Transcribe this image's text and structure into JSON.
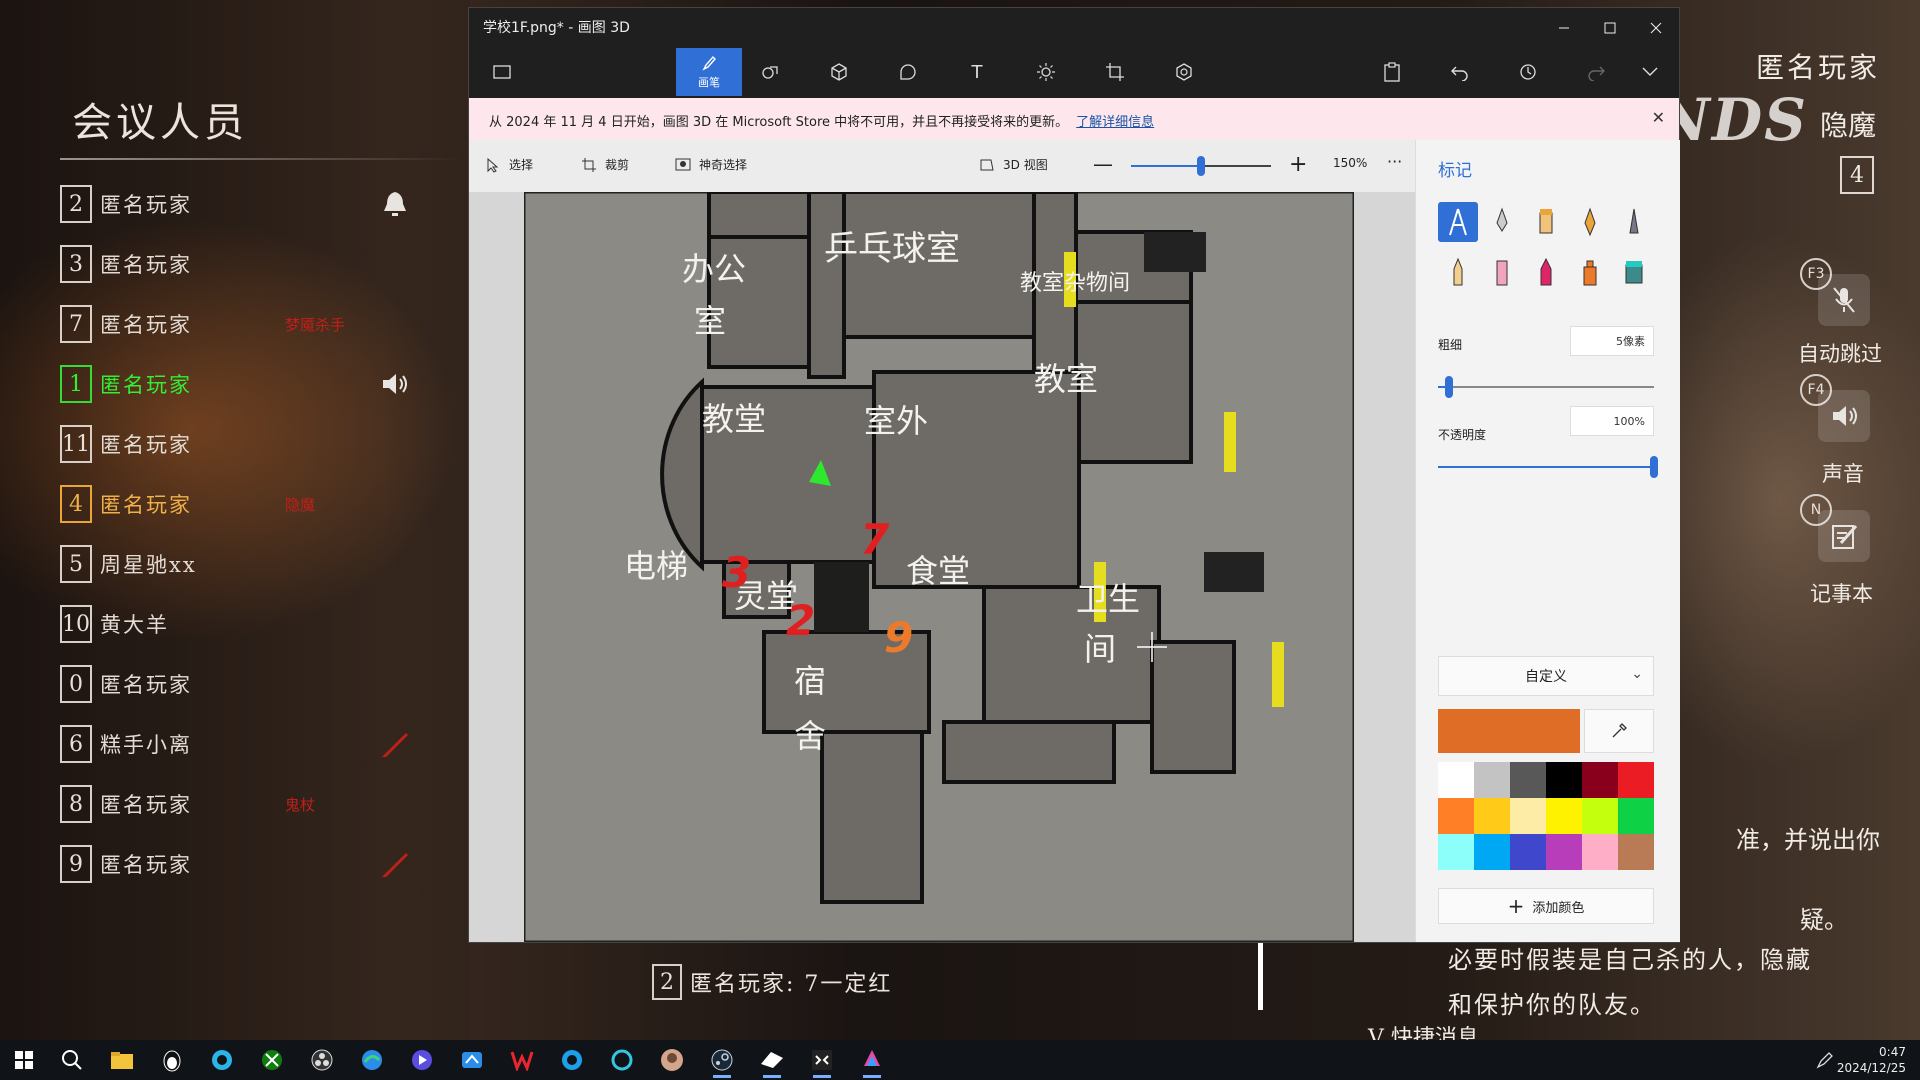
{
  "meeting": {
    "title": "会议人员",
    "players": [
      {
        "num": "2",
        "name": "匿名玩家",
        "style": "normal",
        "note": "",
        "icon": "bell-icon"
      },
      {
        "num": "3",
        "name": "匿名玩家",
        "style": "normal",
        "note": "",
        "icon": ""
      },
      {
        "num": "7",
        "name": "匿名玩家",
        "style": "normal",
        "note": "梦魇杀手",
        "icon": ""
      },
      {
        "num": "1",
        "name": "匿名玩家",
        "style": "green",
        "note": "",
        "icon": "speaker-icon"
      },
      {
        "num": "11",
        "name": "匿名玩家",
        "style": "normal",
        "note": "",
        "icon": ""
      },
      {
        "num": "4",
        "name": "匿名玩家",
        "style": "orange",
        "note": "隐魔",
        "icon": ""
      },
      {
        "num": "5",
        "name": "周星驰xx",
        "style": "normal",
        "note": "",
        "icon": ""
      },
      {
        "num": "10",
        "name": "黄大羊",
        "style": "normal",
        "note": "",
        "icon": ""
      },
      {
        "num": "0",
        "name": "匿名玩家",
        "style": "normal",
        "note": "",
        "icon": ""
      },
      {
        "num": "6",
        "name": "糕手小离",
        "style": "normal",
        "note": "",
        "icon": "knife-icon"
      },
      {
        "num": "8",
        "name": "匿名玩家",
        "style": "normal",
        "note": "鬼杖",
        "icon": ""
      },
      {
        "num": "9",
        "name": "匿名玩家",
        "style": "normal",
        "note": "",
        "icon": "knife-icon"
      }
    ]
  },
  "hud": {
    "player_name": "匿名玩家",
    "brand": "NDS",
    "role": "隐魔",
    "role_number": "4",
    "keys": {
      "f3": "F3",
      "f4": "F4",
      "n": "N"
    },
    "auto_skip_label": "自动跳过",
    "sound_label": "声音",
    "notes_label": "记事本"
  },
  "info_box": {
    "partial_1": "准，并说出你",
    "partial_2": "疑。",
    "line_1": "必要时假装是自己杀的人，隐藏",
    "line_2": "和保护你的队友。",
    "partial_3": "V 快捷消息"
  },
  "chat": {
    "num": "2",
    "text": "匿名玩家: 7一定红"
  },
  "paint": {
    "window_title": "学校1F.png* - 画图 3D",
    "ribbon": {
      "active_tool_label": "画笔",
      "tools": [
        "menu-icon",
        "brushes-icon",
        "2d-shapes-icon",
        "3d-shapes-icon",
        "stickers-icon",
        "text-icon",
        "effects-icon",
        "canvas-icon",
        "3d-library-icon"
      ]
    },
    "notice": {
      "text": "从 2024 年 11 月 4 日开始，画图 3D 在 Microsoft Store 中将不可用，并且不再接受将来的更新。",
      "link": "了解详细信息"
    },
    "toolbar": {
      "select": "选择",
      "crop": "裁剪",
      "magic_select": "神奇选择",
      "view_3d": "3D 视图",
      "zoom": "150%",
      "zoom_fraction": 0.5,
      "more": "···"
    },
    "map": {
      "rooms": [
        "乒乓球室",
        "办公",
        "室",
        "教室杂物间",
        "教室",
        "教堂",
        "室外",
        "电梯",
        "灵堂",
        "食堂",
        "卫生",
        "间",
        "宿",
        "舍"
      ],
      "annotations": [
        "3",
        "7",
        "2",
        "9"
      ]
    },
    "panel": {
      "title": "标记",
      "thickness_label": "粗细",
      "thickness_value": "5像素",
      "thickness_fraction": 0.05,
      "opacity_label": "不透明度",
      "opacity_value": "100%",
      "opacity_fraction": 1.0,
      "color_mode": "自定义",
      "current_color": "#e06d25",
      "add_color_label": "添加颜色",
      "palette": [
        "#ffffff",
        "#c3c3c3",
        "#585858",
        "#000000",
        "#88001b",
        "#ec1c24",
        "#ff7f27",
        "#ffca18",
        "#fdeca6",
        "#fff200",
        "#c4ff0e",
        "#0ed145",
        "#8cfffb",
        "#00a8f3",
        "#3f48cc",
        "#b83dba",
        "#ffaec8",
        "#b97a56"
      ]
    }
  },
  "taskbar": {
    "time": "0:47",
    "date": "2024/12/25"
  }
}
